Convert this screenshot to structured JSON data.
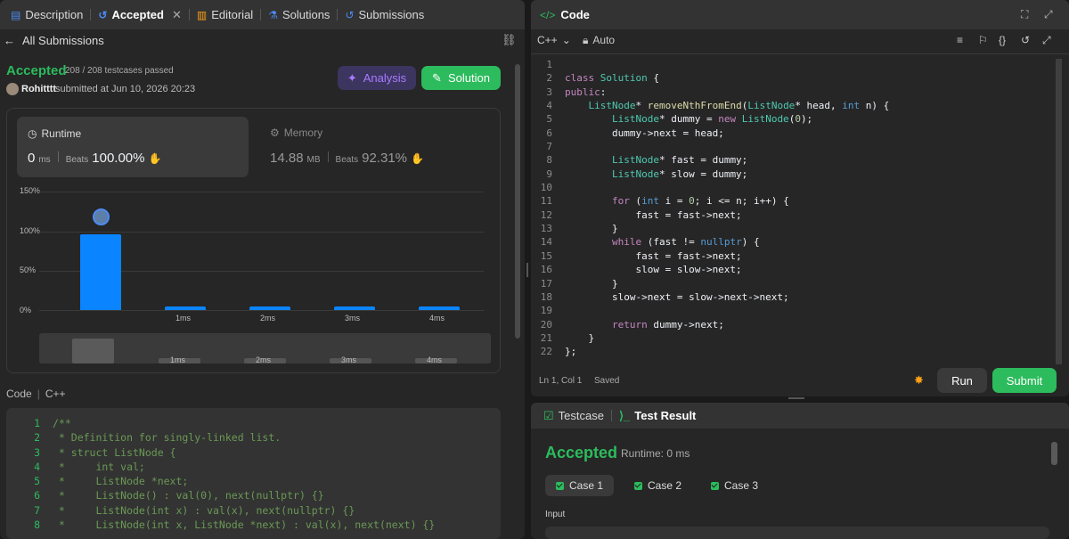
{
  "left_tabs": [
    "Description",
    "Accepted",
    "Editorial",
    "Solutions",
    "Submissions"
  ],
  "back_label": "All Submissions",
  "status": "Accepted",
  "testcases": "208 / 208 testcases passed",
  "user": "Rohitttt",
  "submitted": "submitted at Jun 10, 2026 20:23",
  "analysis_label": "Analysis",
  "solution_label": "Solution",
  "runtime": {
    "label": "Runtime",
    "value": "0",
    "unit": "ms",
    "beats_label": "Beats",
    "beats": "100.00%"
  },
  "memory": {
    "label": "Memory",
    "value": "14.88",
    "unit": "MB",
    "beats_label": "Beats",
    "beats": "92.31%"
  },
  "chart_data": {
    "type": "bar",
    "categories": [
      "",
      "1ms",
      "2ms",
      "3ms",
      "4ms"
    ],
    "values": [
      96,
      3,
      3,
      3,
      3
    ],
    "ylim": [
      0,
      150
    ],
    "yticks": [
      "150%",
      "100%",
      "50%",
      "0%"
    ],
    "grid": true
  },
  "code_section": {
    "label": "Code",
    "lang": "C++"
  },
  "left_code": [
    "/**",
    " * Definition for singly-linked list.",
    " * struct ListNode {",
    " *     int val;",
    " *     ListNode *next;",
    " *     ListNode() : val(0), next(nullptr) {}",
    " *     ListNode(int x) : val(x), next(nullptr) {}",
    " *     ListNode(int x, ListNode *next) : val(x), next(next) {}"
  ],
  "editor": {
    "title": "Code",
    "lang": "C++",
    "auto": "Auto",
    "status_pos": "Ln 1, Col 1",
    "status_saved": "Saved",
    "run": "Run",
    "submit": "Submit"
  },
  "editor_code": [
    "",
    "class Solution {",
    "public:",
    "    ListNode* removeNthFromEnd(ListNode* head, int n) {",
    "        ListNode* dummy = new ListNode(0);",
    "        dummy->next = head;",
    "",
    "        ListNode* fast = dummy;",
    "        ListNode* slow = dummy;",
    "",
    "        for (int i = 0; i <= n; i++) {",
    "            fast = fast->next;",
    "        }",
    "        while (fast != nullptr) {",
    "            fast = fast->next;",
    "            slow = slow->next;",
    "        }",
    "        slow->next = slow->next->next;",
    "",
    "        return dummy->next;",
    "    }",
    "};"
  ],
  "bottom_tabs": [
    "Testcase",
    "Test Result"
  ],
  "result": {
    "status": "Accepted",
    "runtime": "Runtime: 0 ms",
    "cases": [
      "Case 1",
      "Case 2",
      "Case 3"
    ],
    "input_label": "Input"
  },
  "colors": {
    "accent_green": "#2cbb5d",
    "accent_blue": "#0a84ff",
    "analysis_purple": "#a97bff"
  }
}
